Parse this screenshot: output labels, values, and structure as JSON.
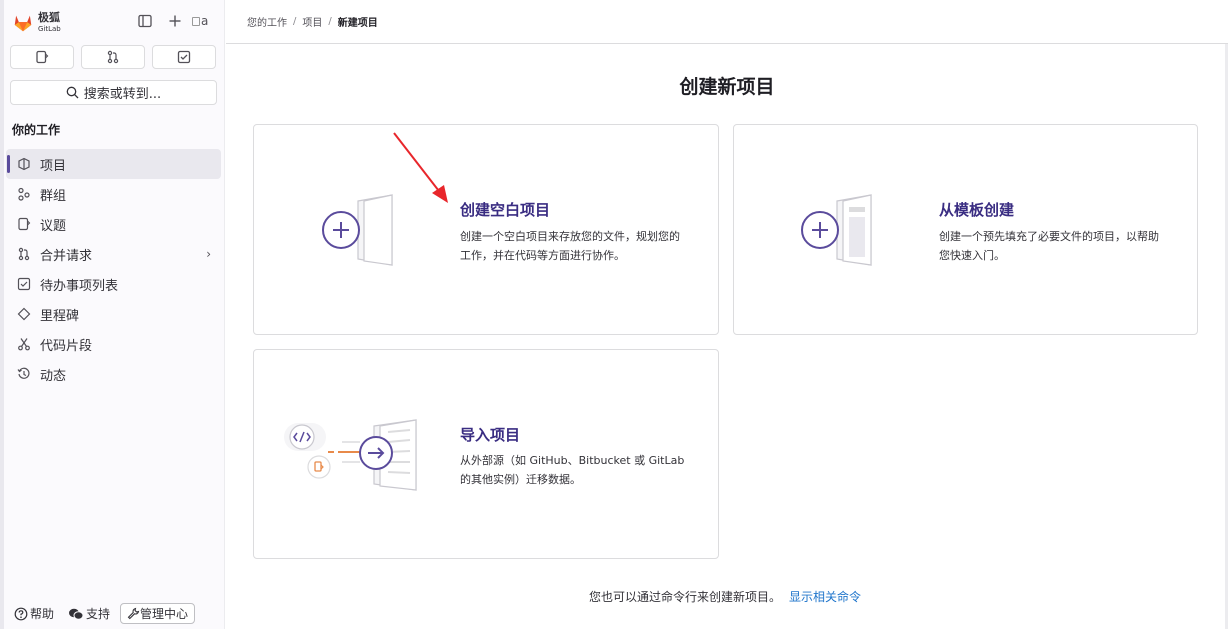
{
  "brand": {
    "name": "极狐",
    "sub": "GitLab"
  },
  "header": {
    "avatar_text": "a"
  },
  "search": {
    "label": "搜索或转到..."
  },
  "sidebar": {
    "section_title": "你的工作",
    "items": [
      {
        "label": "项目",
        "icon": "project-icon",
        "active": true
      },
      {
        "label": "群组",
        "icon": "group-icon"
      },
      {
        "label": "议题",
        "icon": "issues-icon"
      },
      {
        "label": "合并请求",
        "icon": "merge-request-icon",
        "has_chevron": true
      },
      {
        "label": "待办事项列表",
        "icon": "todo-icon"
      },
      {
        "label": "里程碑",
        "icon": "milestone-icon"
      },
      {
        "label": "代码片段",
        "icon": "snippet-icon"
      },
      {
        "label": "动态",
        "icon": "activity-icon"
      }
    ],
    "chevron": "›",
    "bottom": {
      "help": "帮助",
      "support": "支持",
      "admin": "管理中心"
    }
  },
  "breadcrumb": {
    "items": [
      "您的工作",
      "项目",
      "新建项目"
    ],
    "separator": "/"
  },
  "page": {
    "title": "创建新项目"
  },
  "cards": {
    "blank": {
      "title": "创建空白项目",
      "desc_line1": "创建一个空白项目来存放您的文件，规划您的",
      "desc_line2": "工作，并在代码等方面进行协作。"
    },
    "template": {
      "title": "从模板创建",
      "desc_line1": "创建一个预先填充了必要文件的项目，以帮助",
      "desc_line2": "您快速入门。"
    },
    "import": {
      "title": "导入项目",
      "desc_line1": "从外部源（如 GitHub、Bitbucket 或 GitLab",
      "desc_line2": "的其他实例）迁移数据。"
    }
  },
  "footer": {
    "text": "您也可以通过命令行来创建新项目。",
    "link": "显示相关命令"
  },
  "colors": {
    "accent": "#5a4b9c",
    "title": "#3a2d82",
    "link": "#1f75cb",
    "annotation": "#e8262b"
  }
}
